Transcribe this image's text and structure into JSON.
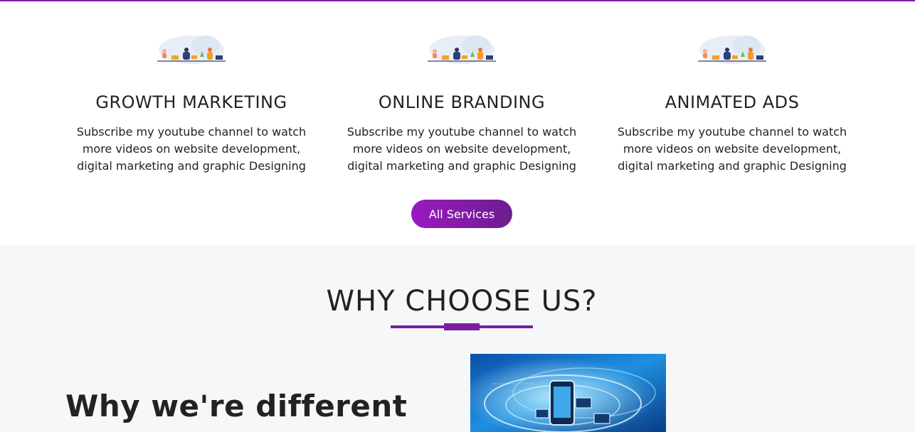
{
  "services": {
    "items": [
      {
        "title": "GROWTH MARKETING",
        "description": "Subscribe my youtube channel to watch more videos on website development, digital marketing and graphic Designing"
      },
      {
        "title": "ONLINE BRANDING",
        "description": "Subscribe my youtube channel to watch more videos on website development, digital marketing and graphic Designing"
      },
      {
        "title": "ANIMATED ADS",
        "description": "Subscribe my youtube channel to watch more videos on website development, digital marketing and graphic Designing"
      }
    ],
    "button_label": "All Services"
  },
  "why": {
    "title": "WHY CHOOSE US?",
    "subheading": "Why we're different"
  },
  "colors": {
    "accent": "#7a1fa2",
    "button_start": "#9a1ac0",
    "button_end": "#6c1d8e",
    "section_bg": "#f6f7f9"
  },
  "icons": [
    "team-illustration-icon",
    "technology-network-image"
  ]
}
